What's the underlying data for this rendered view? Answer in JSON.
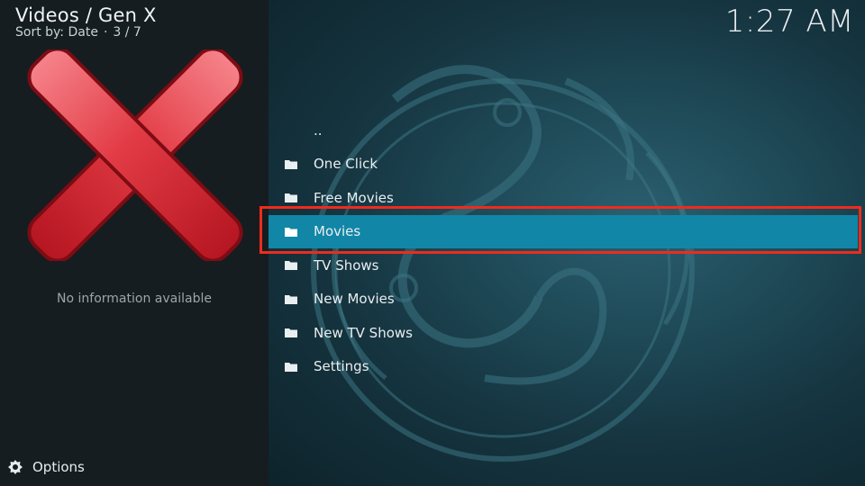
{
  "header": {
    "title": "Videos / Gen X",
    "sort_label": "Sort by: Date",
    "position": "3 / 7"
  },
  "clock": "1:27 AM",
  "info_panel": {
    "no_info_text": "No information available",
    "thumbnail_icon": "red-x-icon"
  },
  "footer": {
    "options_label": "Options",
    "options_icon": "gear-icon"
  },
  "list": {
    "items": [
      {
        "label": "..",
        "icon": "none"
      },
      {
        "label": "One Click",
        "icon": "folder-icon"
      },
      {
        "label": "Free Movies",
        "icon": "folder-icon"
      },
      {
        "label": "Movies",
        "icon": "folder-icon",
        "selected": true
      },
      {
        "label": "TV Shows",
        "icon": "folder-icon"
      },
      {
        "label": "New Movies",
        "icon": "folder-icon"
      },
      {
        "label": "New TV Shows",
        "icon": "folder-icon"
      },
      {
        "label": "Settings",
        "icon": "folder-icon"
      }
    ]
  },
  "colors": {
    "selected_row": "#1286a6",
    "highlight_border": "#ef2b1c",
    "panel_bg": "#151d20"
  }
}
